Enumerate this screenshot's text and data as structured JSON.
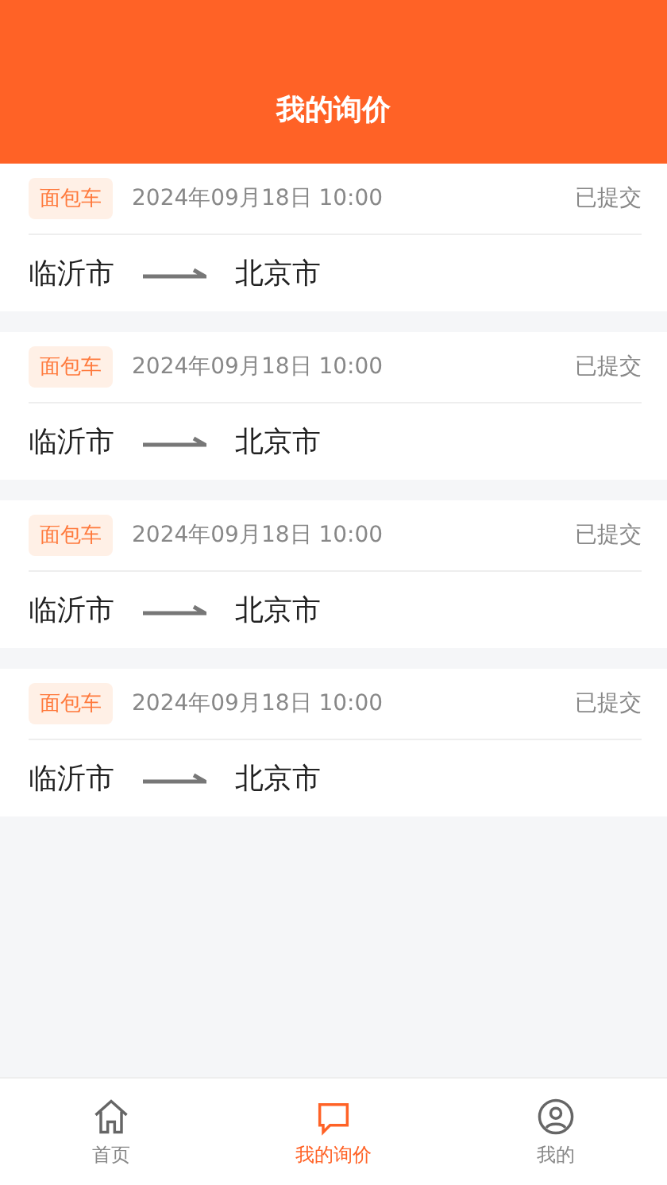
{
  "header": {
    "title": "我的询价"
  },
  "inquiries": [
    {
      "vehicle": "面包车",
      "time": "2024年09月18日 10:00",
      "status": "已提交",
      "from": "临沂市",
      "to": "北京市"
    },
    {
      "vehicle": "面包车",
      "time": "2024年09月18日 10:00",
      "status": "已提交",
      "from": "临沂市",
      "to": "北京市"
    },
    {
      "vehicle": "面包车",
      "time": "2024年09月18日 10:00",
      "status": "已提交",
      "from": "临沂市",
      "to": "北京市"
    },
    {
      "vehicle": "面包车",
      "time": "2024年09月18日 10:00",
      "status": "已提交",
      "from": "临沂市",
      "to": "北京市"
    }
  ],
  "tabs": [
    {
      "kind": "home",
      "label": "首页",
      "selected": false
    },
    {
      "kind": "inquiry",
      "label": "我的询价",
      "selected": true
    },
    {
      "kind": "profile",
      "label": "我的",
      "selected": false
    }
  ]
}
